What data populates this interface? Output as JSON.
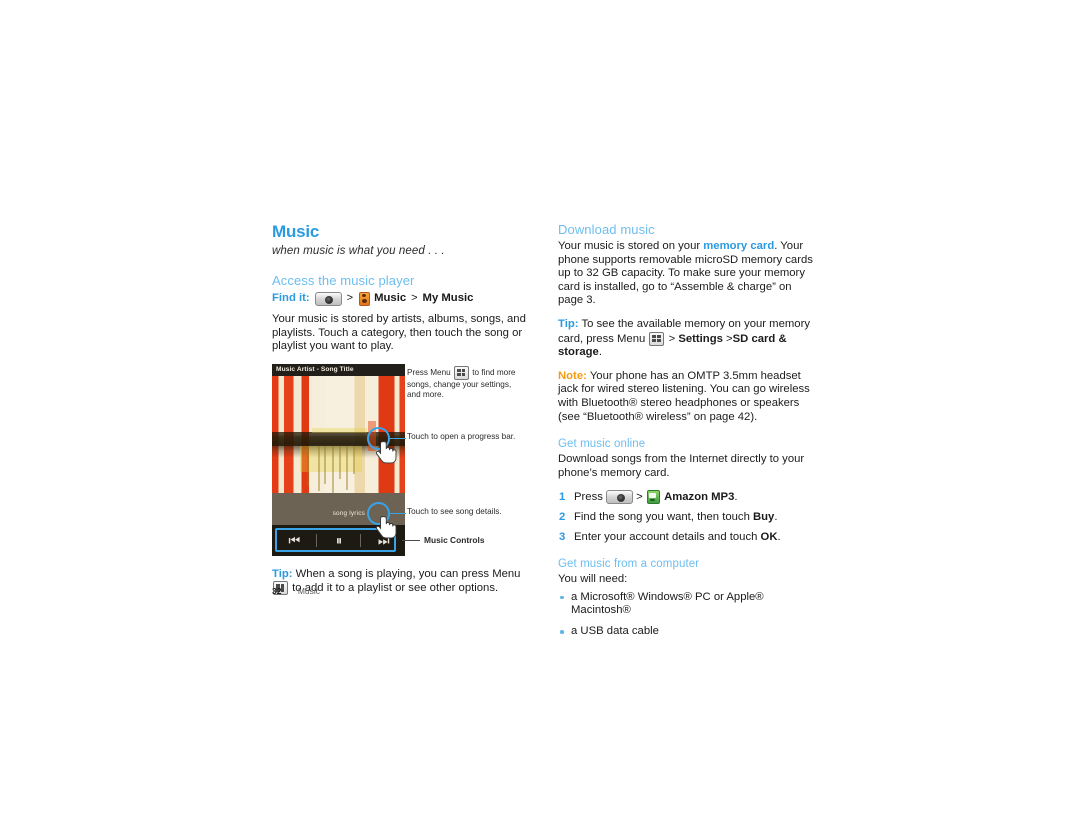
{
  "page": {
    "number": "32",
    "chapter_footer": "Music"
  },
  "colors": {
    "title_blue": "#2a9ae1",
    "heading_blue": "#6dbdf0",
    "accent_orange": "#f59b14",
    "highlight_blue": "#3aa3e8"
  },
  "left_column": {
    "title": "Music",
    "tagline": "when music is what you need . . .",
    "section_heading": "Access the music player",
    "find_it": {
      "label": "Find it:",
      "home_key_icon": "home-key-icon",
      "sep1": ">",
      "music_icon": "music-app-icon",
      "app_label": "Music",
      "sep2": ">",
      "destination": "My Music"
    },
    "body_paragraph": "Your music is stored by artists, albums, songs, and playlists. Touch a category, then touch the song or playlist you want to play.",
    "figure": {
      "phone_title_bar": "Music Artist - Song Title",
      "lyrics_label": "song lyrics",
      "controls": {
        "previous": "⏮",
        "pause": "⏸",
        "next": "⏭"
      },
      "callouts": [
        {
          "id": "menu-callout",
          "text_before": "Press Menu",
          "icon": "menu-key-icon",
          "text_after": "to find more songs, change your settings, and more."
        },
        {
          "id": "progress-callout",
          "text": "Touch to open a progress bar."
        },
        {
          "id": "details-callout",
          "text": "Touch to see song details."
        },
        {
          "id": "controls-callout",
          "text": "Music Controls"
        }
      ]
    },
    "tip": {
      "lead": "Tip:",
      "text_before": "When a song is playing, you can press Menu",
      "icon": "menu-key-icon",
      "text_after": "to add it to a playlist or see other options."
    }
  },
  "right_column": {
    "section_heading": "Download music",
    "intro": {
      "part1": "Your music is stored on your ",
      "link": "memory card",
      "part2": ". Your phone supports removable microSD memory cards up to 32 GB capacity. To make sure your memory card is installed, go to “Assemble & charge” on page 3."
    },
    "tip": {
      "lead": "Tip:",
      "text_before": "To see the available memory on your memory card, press Menu",
      "icon": "menu-key-icon",
      "sep1": ">",
      "bold1": "Settings",
      "sep2": ">",
      "bold2": "SD card & storage",
      "text_after": "."
    },
    "note": {
      "lead": "Note:",
      "text": "Your phone has an OMTP 3.5mm headset jack for wired stereo listening. You can go wireless with Bluetooth® stereo headphones or speakers (see “Bluetooth® wireless” on page 42)."
    },
    "get_music_online": {
      "heading": "Get music online",
      "intro": "Download songs from the Internet directly to your phone’s memory card.",
      "steps": [
        {
          "num": "1",
          "text_before": "Press",
          "home_icon": "home-key-icon",
          "sep": ">",
          "app_icon": "amazon-mp3-icon",
          "bold": "Amazon MP3",
          "text_after": "."
        },
        {
          "num": "2",
          "text_before": "Find the song you want, then touch",
          "bold": "Buy",
          "text_after": "."
        },
        {
          "num": "3",
          "text_before": "Enter your account details and touch",
          "bold": "OK",
          "text_after": "."
        }
      ]
    },
    "get_music_computer": {
      "heading": "Get music from a computer",
      "intro": "You will need:",
      "bullets": [
        "a Microsoft® Windows® PC or Apple® Macintosh®",
        "a USB data cable"
      ]
    }
  }
}
